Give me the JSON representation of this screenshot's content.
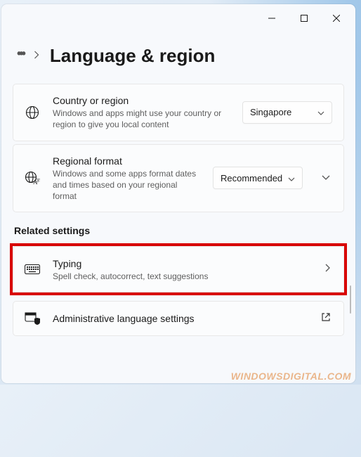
{
  "breadcrumb": {
    "title": "Language & region"
  },
  "cards": {
    "country": {
      "title": "Country or region",
      "desc": "Windows and apps might use your country or region to give you local content",
      "value": "Singapore"
    },
    "regional": {
      "title": "Regional format",
      "desc": "Windows and some apps format dates and times based on your regional format",
      "value": "Recommended"
    }
  },
  "section_heading": "Related settings",
  "related": {
    "typing": {
      "title": "Typing",
      "desc": "Spell check, autocorrect, text suggestions"
    },
    "admin": {
      "title": "Administrative language settings"
    }
  },
  "watermark": "WINDOWSDIGITAL.COM"
}
